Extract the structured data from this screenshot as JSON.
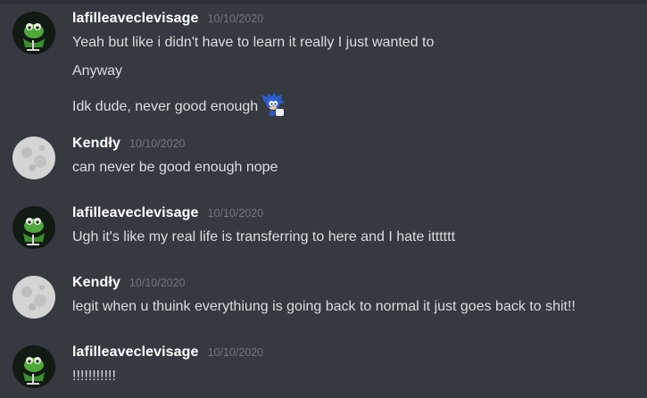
{
  "messages": [
    {
      "username": "lafilleaveclevisage",
      "timestamp": "10/10/2020",
      "avatar_icon": "kermit-avatar-icon",
      "lines": [
        "Yeah but like i didn't have to learn it really I just wanted to",
        "Anyway",
        "Idk dude, never good enough"
      ],
      "emoji": "sonic-emoji-icon"
    },
    {
      "username": "Kendły",
      "timestamp": "10/10/2020",
      "avatar_icon": "moon-avatar-icon",
      "lines": [
        "can never be good enough nope"
      ]
    },
    {
      "username": "lafilleaveclevisage",
      "timestamp": "10/10/2020",
      "avatar_icon": "kermit-avatar-icon",
      "lines": [
        "Ugh it's like my real life is transferring to here and I hate itttttt"
      ]
    },
    {
      "username": "Kendły",
      "timestamp": "10/10/2020",
      "avatar_icon": "moon-avatar-icon",
      "lines": [
        "legit when u thuink everythiung is going back to normal it just goes back to shit!!"
      ]
    },
    {
      "username": "lafilleaveclevisage",
      "timestamp": "10/10/2020",
      "avatar_icon": "kermit-avatar-icon",
      "lines": [
        "!!!!!!!!!!!"
      ]
    }
  ],
  "colors": {
    "background": "#36393f",
    "username": "#ffffff",
    "timestamp": "#72767d",
    "text": "#dcddde"
  }
}
